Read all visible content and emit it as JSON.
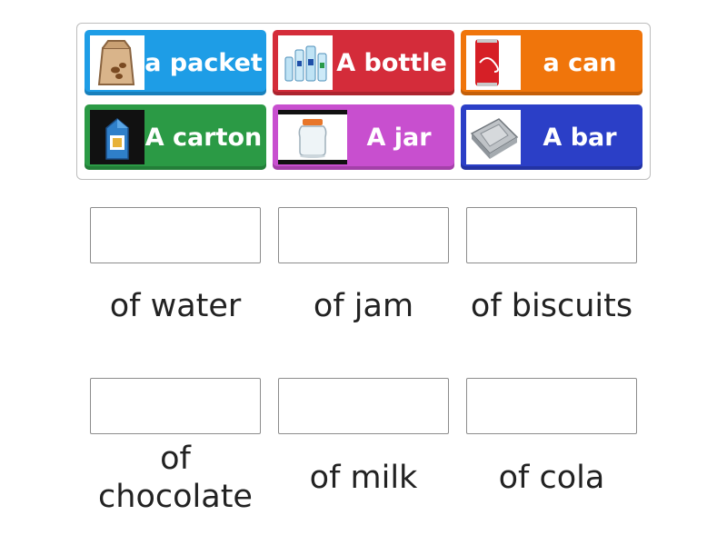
{
  "tiles": [
    {
      "label": "a packet",
      "color": "#1e9de6",
      "icon": "packet-bag-icon"
    },
    {
      "label": "A bottle",
      "color": "#d42c3a",
      "icon": "water-bottles-icon"
    },
    {
      "label": "a can",
      "color": "#f0750b",
      "icon": "cola-can-icon"
    },
    {
      "label": "A carton",
      "color": "#2b9a45",
      "icon": "milk-carton-icon"
    },
    {
      "label": "A jar",
      "color": "#c84fcf",
      "icon": "glass-jar-icon"
    },
    {
      "label": "A bar",
      "color": "#2b3fc7",
      "icon": "silver-bar-icon"
    }
  ],
  "targets": [
    {
      "phrase": "of water"
    },
    {
      "phrase": "of jam"
    },
    {
      "phrase": "of biscuits"
    },
    {
      "phrase": "of chocolate"
    },
    {
      "phrase": "of milk"
    },
    {
      "phrase": "of cola"
    }
  ]
}
